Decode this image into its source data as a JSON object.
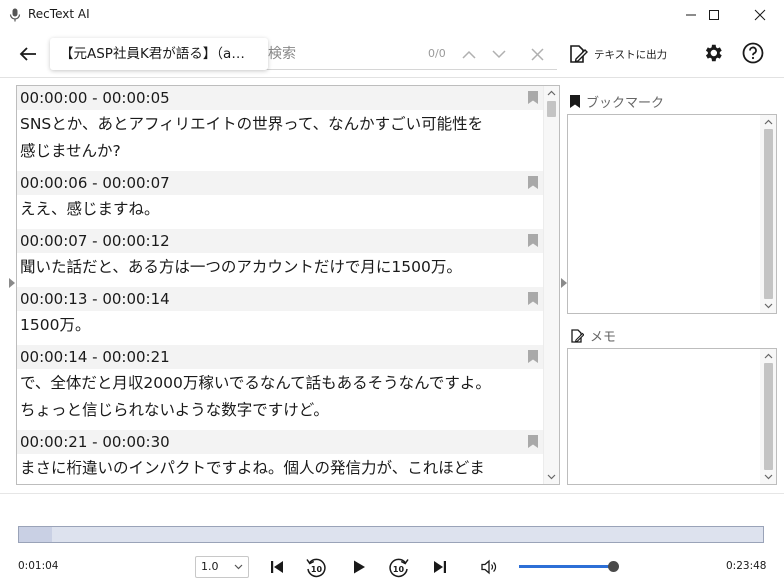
{
  "window": {
    "title": "RecText AI"
  },
  "toolbar": {
    "document_title": "【元ASP社員K君が語る】（a…",
    "search_placeholder": "検索",
    "search_count": "0/0",
    "export_label": "テキストに出力"
  },
  "transcript": {
    "entries": [
      {
        "time": "00:00:00 - 00:00:05",
        "lines": [
          "SNSとか、あとアフィリエイトの世界って、なんかすごい可能性を",
          "感じませんか?"
        ]
      },
      {
        "time": "00:00:06 - 00:00:07",
        "lines": [
          "ええ、感じますね。"
        ]
      },
      {
        "time": "00:00:07 - 00:00:12",
        "lines": [
          "聞いた話だと、ある方は一つのアカウントだけで月に1500万。"
        ]
      },
      {
        "time": "00:00:13 - 00:00:14",
        "lines": [
          "1500万。"
        ]
      },
      {
        "time": "00:00:14 - 00:00:21",
        "lines": [
          "で、全体だと月収2000万稼いでるなんて話もあるそうなんですよ。",
          "ちょっと信じられないような数字ですけど。"
        ]
      },
      {
        "time": "00:00:21 - 00:00:30",
        "lines": [
          "まさに桁違いのインパクトですよね。個人の発信力が、これほどま"
        ]
      }
    ]
  },
  "panels": {
    "bookmark_label": "ブックマーク",
    "memo_label": "メモ"
  },
  "player": {
    "current_time": "0:01:04",
    "total_time": "0:23:48",
    "progress_fraction": 0.0448,
    "speed": "1.0",
    "skip_seconds": "10",
    "volume_fraction": 0.98
  },
  "colors": {
    "volume_fill": "#2d6fd6",
    "progress_track": "#dde2ee"
  }
}
